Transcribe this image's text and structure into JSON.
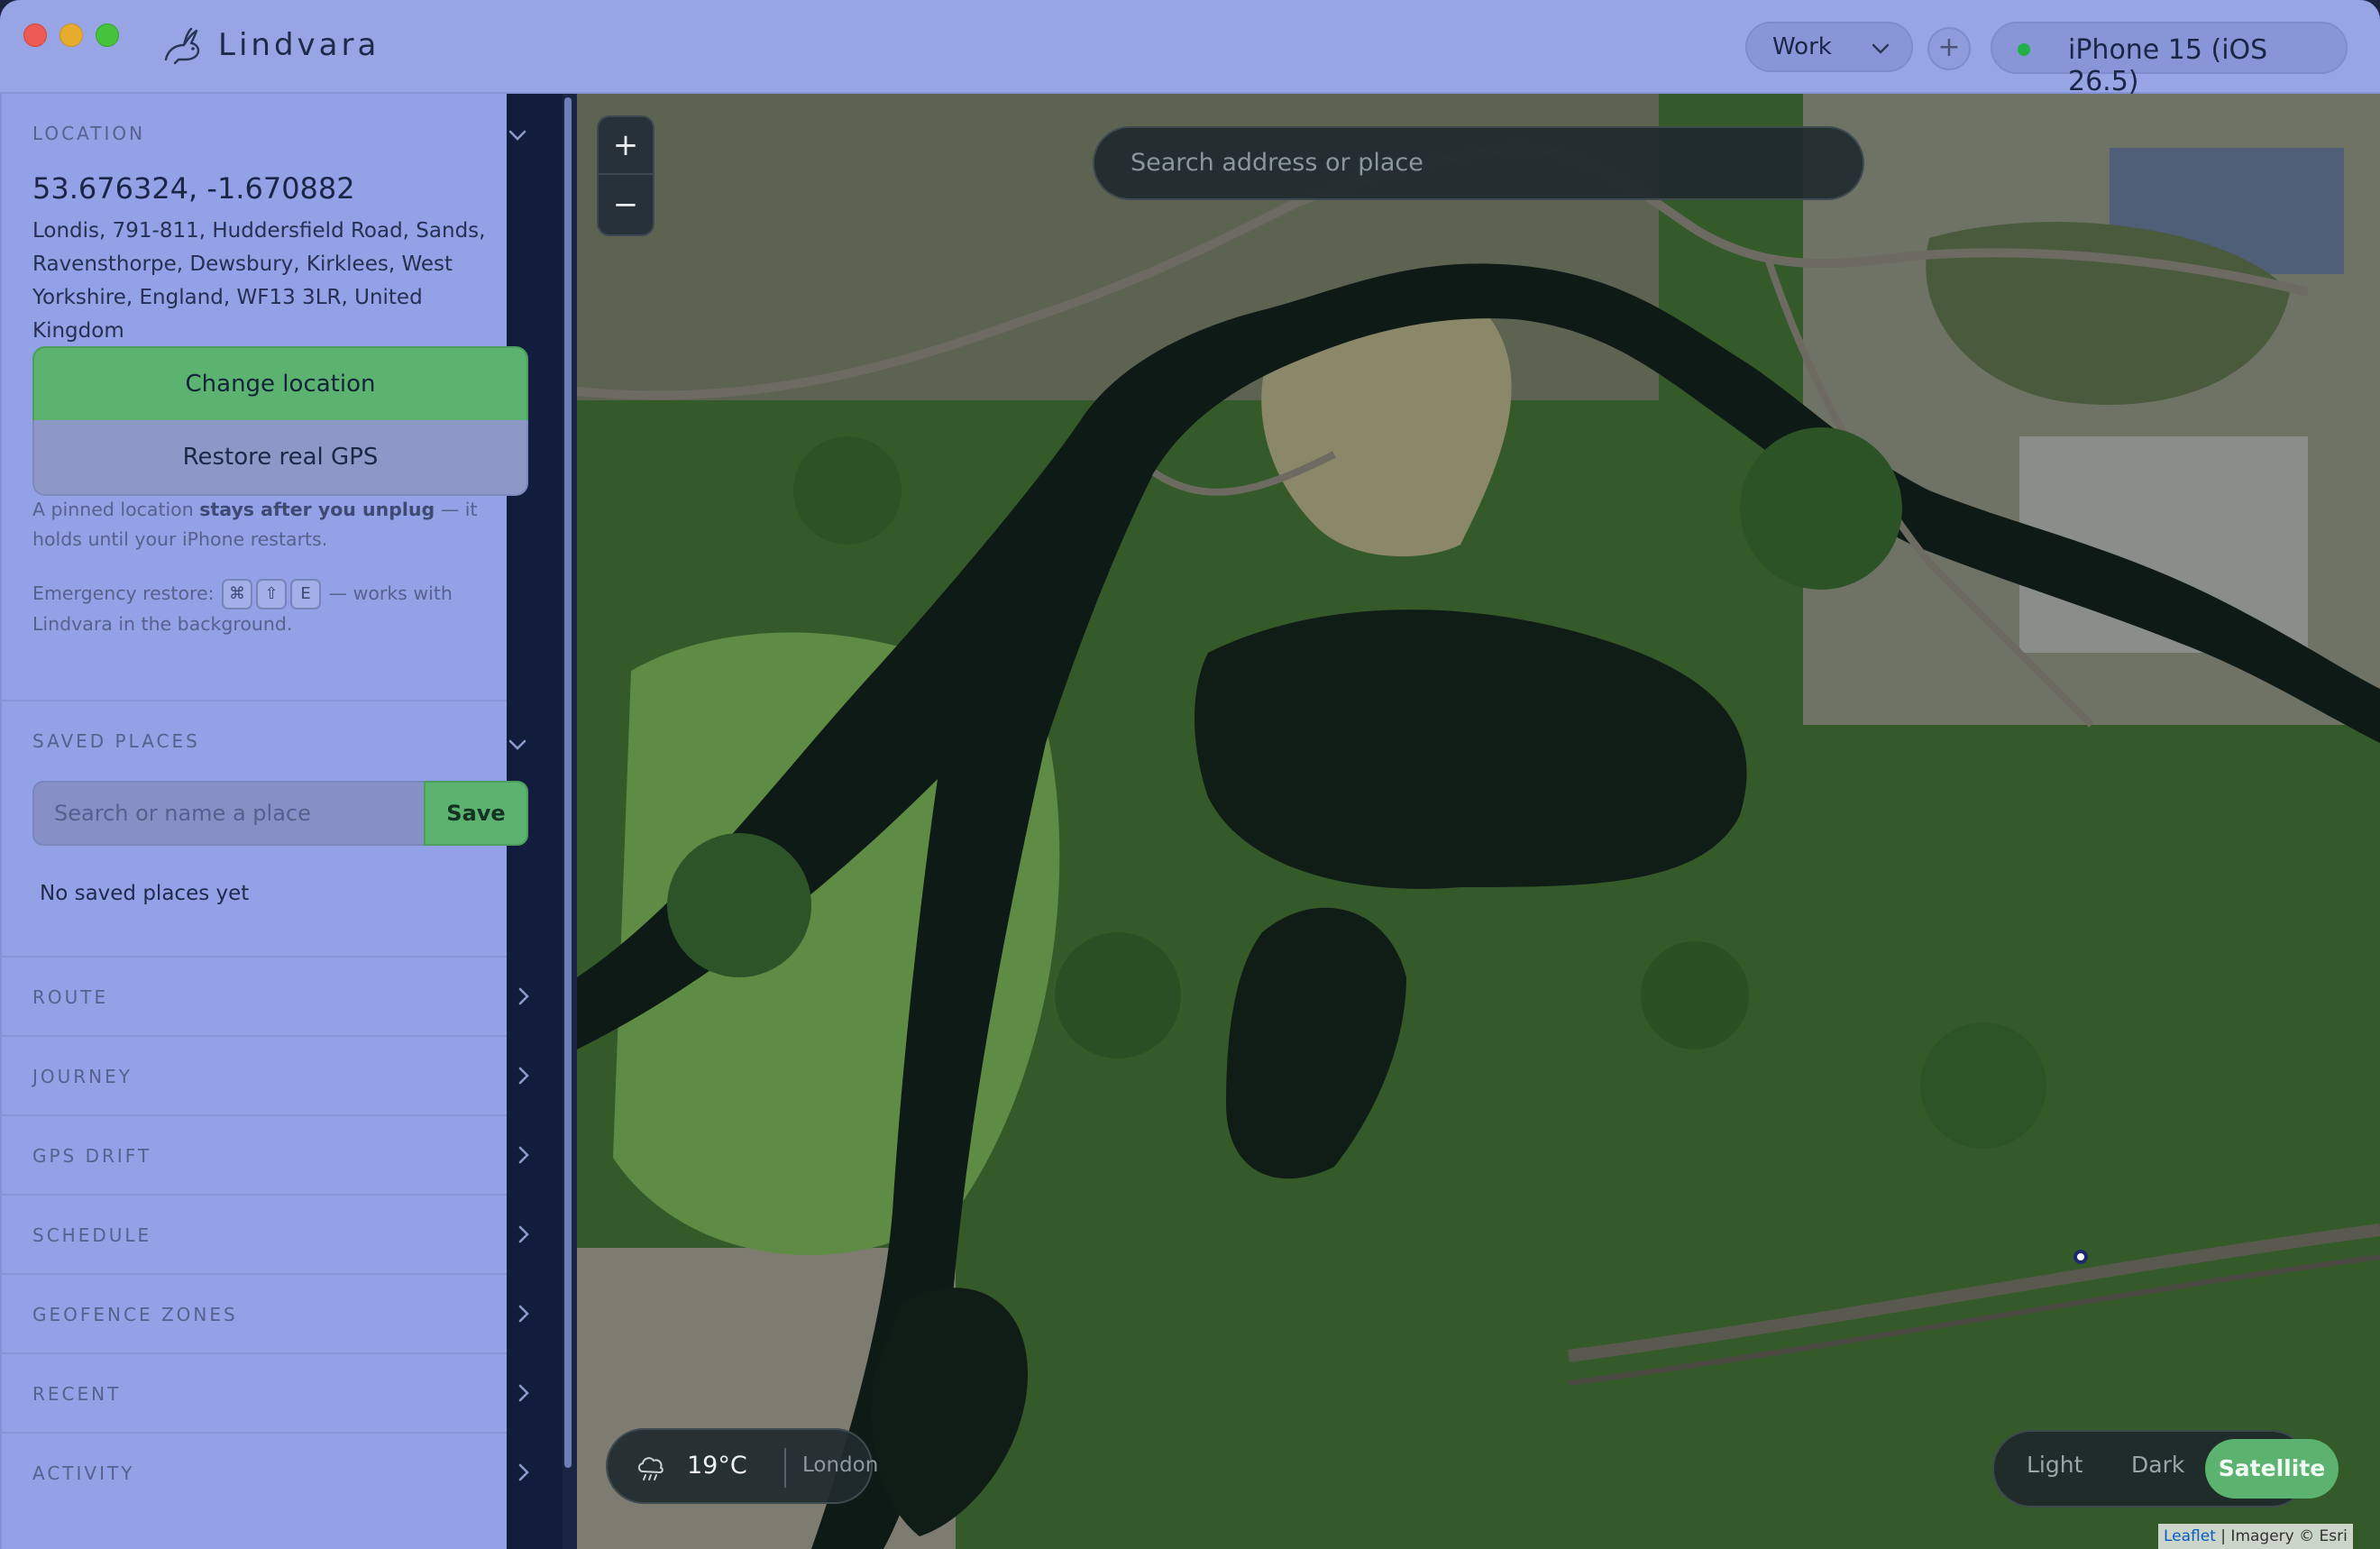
{
  "app": {
    "name": "Lindvara"
  },
  "header": {
    "profile": "Work",
    "add_label": "+",
    "device": "iPhone 15 (iOS 26.5)",
    "device_status_color": "#22b04b"
  },
  "location": {
    "heading": "LOCATION",
    "coords": "53.676324, -1.670882",
    "address": "Londis, 791-811, Huddersfield Road, Sands, Ravensthorpe, Dewsbury, Kirklees, West Yorkshire, England, WF13 3LR, United Kingdom",
    "change_button": "Change location",
    "restore_button": "Restore real GPS",
    "note_prefix": "A pinned location ",
    "note_bold": "stays after you unplug",
    "note_suffix": " — it holds until your iPhone restarts.",
    "emergency_label": "Emergency restore:",
    "keys": [
      "⌘",
      "⇧",
      "E"
    ],
    "emergency_suffix": "— works with Lindvara in the background."
  },
  "saved_places": {
    "heading": "SAVED PLACES",
    "placeholder": "Search or name a place",
    "save_button": "Save",
    "empty": "No saved places yet"
  },
  "sections": [
    "ROUTE",
    "JOURNEY",
    "GPS DRIFT",
    "SCHEDULE",
    "GEOFENCE ZONES",
    "RECENT",
    "ACTIVITY"
  ],
  "map": {
    "search_placeholder": "Search address or place",
    "zoom_in": "+",
    "zoom_out": "−",
    "weather": {
      "temp": "19°C",
      "city": "London",
      "icon": "cloud-rain-icon"
    },
    "styles": {
      "light": "Light",
      "dark": "Dark",
      "satellite": "Satellite",
      "selected": "Satellite"
    },
    "attribution_leaflet": "Leaflet",
    "attribution_rest": "| Imagery © Esri"
  },
  "colors": {
    "accent_green": "#5bb36f",
    "sidebar_bg": "#93a1e6",
    "titlebar_bg": "#98a5e4"
  }
}
